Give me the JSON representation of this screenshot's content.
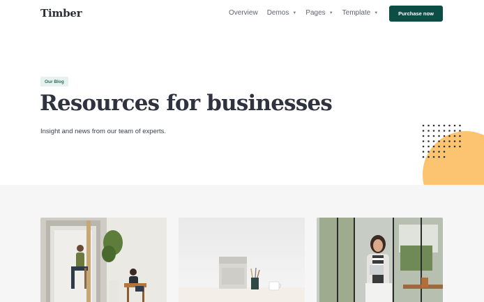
{
  "header": {
    "logo": "Timber",
    "nav": [
      {
        "label": "Overview",
        "has_caret": false
      },
      {
        "label": "Demos",
        "has_caret": true
      },
      {
        "label": "Pages",
        "has_caret": true
      },
      {
        "label": "Template",
        "has_caret": true
      }
    ],
    "purchase_label": "Purchase now"
  },
  "hero": {
    "badge": "Our Blog",
    "title": "Resources for businesses",
    "subtitle": "Insight and news from our team of experts."
  },
  "icons": {
    "caret": "caret-down-icon"
  },
  "colors": {
    "brand": "#0c4e46",
    "badge_bg": "#e6f2ee",
    "accent_circle": "#fcc470",
    "band_bg": "#f6f6f6"
  },
  "cards": [
    {
      "image": "office-phone-booth-photo"
    },
    {
      "image": "desk-speaker-mug-photo"
    },
    {
      "image": "woman-with-laptop-photo"
    }
  ]
}
